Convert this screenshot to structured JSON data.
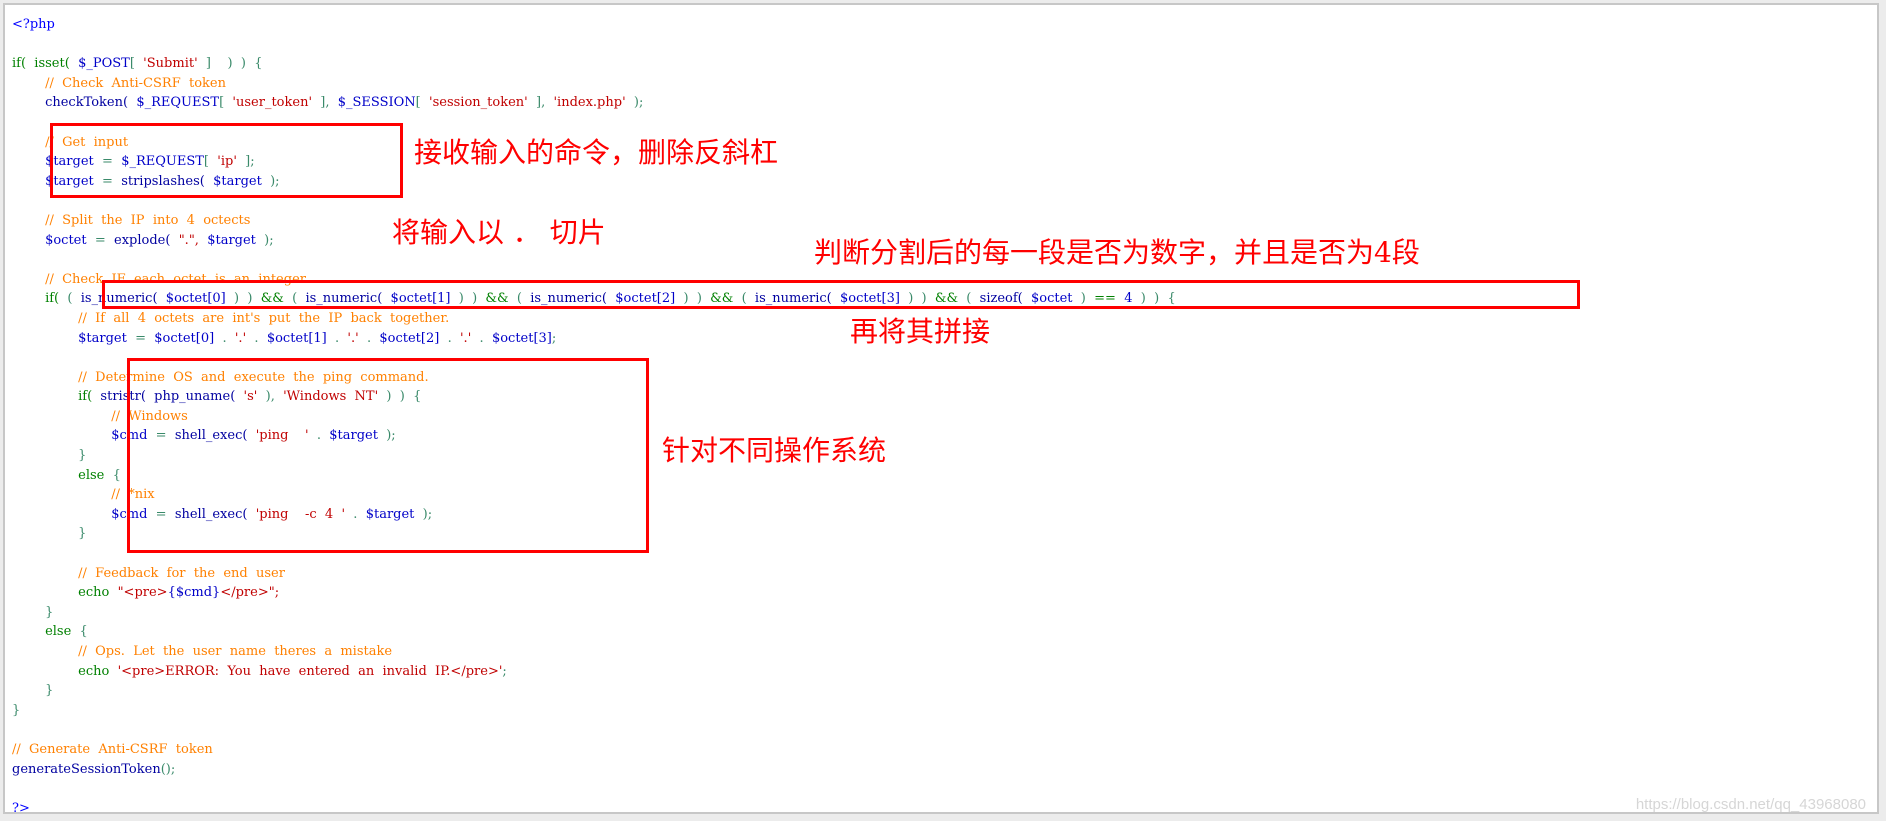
{
  "code": {
    "language": "php",
    "lines": [
      {
        "indent": 0,
        "tokens": [
          {
            "t": "<?php",
            "c": "ph"
          }
        ]
      },
      {
        "indent": 0,
        "tokens": []
      },
      {
        "indent": 0,
        "tokens": [
          {
            "t": "if(",
            "c": "kw"
          },
          {
            "t": "  isset(",
            "c": "kw"
          },
          {
            "t": "  $_POST",
            "c": "var"
          },
          {
            "t": "[",
            "c": "pn"
          },
          {
            "t": "  'Submit'",
            "c": "str"
          },
          {
            "t": "  ]",
            "c": "pn"
          },
          {
            "t": "    )  )  {",
            "c": "pn"
          }
        ]
      },
      {
        "indent": 1,
        "tokens": [
          {
            "t": "//  Check  Anti-CSRF  token",
            "c": "cm"
          }
        ]
      },
      {
        "indent": 1,
        "tokens": [
          {
            "t": "checkToken(",
            "c": "fn"
          },
          {
            "t": "  $_REQUEST",
            "c": "var"
          },
          {
            "t": "[",
            "c": "pn"
          },
          {
            "t": "  'user_token'",
            "c": "str"
          },
          {
            "t": "  ],",
            "c": "pn"
          },
          {
            "t": "  $_SESSION",
            "c": "var"
          },
          {
            "t": "[",
            "c": "pn"
          },
          {
            "t": "  'session_token'",
            "c": "str"
          },
          {
            "t": "  ],",
            "c": "pn"
          },
          {
            "t": "  'index.php'",
            "c": "str"
          },
          {
            "t": "  );",
            "c": "pn"
          }
        ]
      },
      {
        "indent": 0,
        "tokens": []
      },
      {
        "indent": 1,
        "tokens": [
          {
            "t": "//  Get  input",
            "c": "cm"
          }
        ]
      },
      {
        "indent": 1,
        "tokens": [
          {
            "t": "$target",
            "c": "var"
          },
          {
            "t": "  =  ",
            "c": "pn"
          },
          {
            "t": "$_REQUEST",
            "c": "var"
          },
          {
            "t": "[",
            "c": "pn"
          },
          {
            "t": "  'ip'",
            "c": "str"
          },
          {
            "t": "  ];",
            "c": "pn"
          }
        ]
      },
      {
        "indent": 1,
        "tokens": [
          {
            "t": "$target",
            "c": "var"
          },
          {
            "t": "  =  ",
            "c": "pn"
          },
          {
            "t": "stripslashes(",
            "c": "fn"
          },
          {
            "t": "  $target",
            "c": "var"
          },
          {
            "t": "  );",
            "c": "pn"
          }
        ]
      },
      {
        "indent": 0,
        "tokens": []
      },
      {
        "indent": 1,
        "tokens": [
          {
            "t": "//  Split  the  IP  into  4  octects",
            "c": "cm"
          }
        ]
      },
      {
        "indent": 1,
        "tokens": [
          {
            "t": "$octet",
            "c": "var"
          },
          {
            "t": "  =  ",
            "c": "pn"
          },
          {
            "t": "explode(",
            "c": "fn"
          },
          {
            "t": "  \".\",",
            "c": "str"
          },
          {
            "t": "  $target",
            "c": "var"
          },
          {
            "t": "  );",
            "c": "pn"
          }
        ]
      },
      {
        "indent": 0,
        "tokens": []
      },
      {
        "indent": 1,
        "tokens": [
          {
            "t": "//  Check  IF  each  octet  is  an  integer",
            "c": "cm"
          }
        ]
      },
      {
        "indent": 1,
        "tokens": [
          {
            "t": "if(",
            "c": "kw"
          },
          {
            "t": "  (  ",
            "c": "pn"
          },
          {
            "t": "is_numeric(",
            "c": "fn"
          },
          {
            "t": "  $octet[0]",
            "c": "var"
          },
          {
            "t": "  )  )  ",
            "c": "pn"
          },
          {
            "t": "&&",
            "c": "kw"
          },
          {
            "t": "  (  ",
            "c": "pn"
          },
          {
            "t": "is_numeric(",
            "c": "fn"
          },
          {
            "t": "  $octet[1]",
            "c": "var"
          },
          {
            "t": "  )  )  ",
            "c": "pn"
          },
          {
            "t": "&&",
            "c": "kw"
          },
          {
            "t": "  (  ",
            "c": "pn"
          },
          {
            "t": "is_numeric(",
            "c": "fn"
          },
          {
            "t": "  $octet[2]",
            "c": "var"
          },
          {
            "t": "  )  )  ",
            "c": "pn"
          },
          {
            "t": "&&",
            "c": "kw"
          },
          {
            "t": "  (  ",
            "c": "pn"
          },
          {
            "t": "is_numeric(",
            "c": "fn"
          },
          {
            "t": "  $octet[3]",
            "c": "var"
          },
          {
            "t": "  )  )  ",
            "c": "pn"
          },
          {
            "t": "&&",
            "c": "kw"
          },
          {
            "t": "  (  ",
            "c": "pn"
          },
          {
            "t": "sizeof(",
            "c": "fn"
          },
          {
            "t": "  $octet",
            "c": "var"
          },
          {
            "t": "  )  ",
            "c": "pn"
          },
          {
            "t": "==",
            "c": "kw"
          },
          {
            "t": "  4",
            "c": "var"
          },
          {
            "t": "  )  )  {",
            "c": "pn"
          }
        ]
      },
      {
        "indent": 2,
        "tokens": [
          {
            "t": "//  If  all  4  octets  are  int's  put  the  IP  back  together.",
            "c": "cm"
          }
        ]
      },
      {
        "indent": 2,
        "tokens": [
          {
            "t": "$target",
            "c": "var"
          },
          {
            "t": "  =  ",
            "c": "pn"
          },
          {
            "t": "$octet[0]",
            "c": "var"
          },
          {
            "t": "  .  ",
            "c": "pn"
          },
          {
            "t": "'.'",
            "c": "str"
          },
          {
            "t": "  .  ",
            "c": "pn"
          },
          {
            "t": "$octet[1]",
            "c": "var"
          },
          {
            "t": "  .  ",
            "c": "pn"
          },
          {
            "t": "'.'",
            "c": "str"
          },
          {
            "t": "  .  ",
            "c": "pn"
          },
          {
            "t": "$octet[2]",
            "c": "var"
          },
          {
            "t": "  .  ",
            "c": "pn"
          },
          {
            "t": "'.'",
            "c": "str"
          },
          {
            "t": "  .  ",
            "c": "pn"
          },
          {
            "t": "$octet[3]",
            "c": "var"
          },
          {
            "t": ";",
            "c": "pn"
          }
        ]
      },
      {
        "indent": 0,
        "tokens": []
      },
      {
        "indent": 2,
        "tokens": [
          {
            "t": "//  Determine  OS  and  execute  the  ping  command.",
            "c": "cm"
          }
        ]
      },
      {
        "indent": 2,
        "tokens": [
          {
            "t": "if(",
            "c": "kw"
          },
          {
            "t": "  stristr(",
            "c": "fn"
          },
          {
            "t": "  php_uname(",
            "c": "fn"
          },
          {
            "t": "  's'",
            "c": "str"
          },
          {
            "t": "  ),",
            "c": "pn"
          },
          {
            "t": "  'Windows  NT'",
            "c": "str"
          },
          {
            "t": "  )  )  {",
            "c": "pn"
          }
        ]
      },
      {
        "indent": 3,
        "tokens": [
          {
            "t": "//  Windows",
            "c": "cm"
          }
        ]
      },
      {
        "indent": 3,
        "tokens": [
          {
            "t": "$cmd",
            "c": "var"
          },
          {
            "t": "  =  ",
            "c": "pn"
          },
          {
            "t": "shell_exec(",
            "c": "fn"
          },
          {
            "t": "  'ping    '",
            "c": "str"
          },
          {
            "t": "  .  ",
            "c": "pn"
          },
          {
            "t": "$target",
            "c": "var"
          },
          {
            "t": "  );",
            "c": "pn"
          }
        ]
      },
      {
        "indent": 2,
        "tokens": [
          {
            "t": "}",
            "c": "pn"
          }
        ]
      },
      {
        "indent": 2,
        "tokens": [
          {
            "t": "else",
            "c": "kw"
          },
          {
            "t": "  {",
            "c": "pn"
          }
        ]
      },
      {
        "indent": 3,
        "tokens": [
          {
            "t": "//  *nix",
            "c": "cm"
          }
        ]
      },
      {
        "indent": 3,
        "tokens": [
          {
            "t": "$cmd",
            "c": "var"
          },
          {
            "t": "  =  ",
            "c": "pn"
          },
          {
            "t": "shell_exec(",
            "c": "fn"
          },
          {
            "t": "  'ping    -c  4  '",
            "c": "str"
          },
          {
            "t": "  .  ",
            "c": "pn"
          },
          {
            "t": "$target",
            "c": "var"
          },
          {
            "t": "  );",
            "c": "pn"
          }
        ]
      },
      {
        "indent": 2,
        "tokens": [
          {
            "t": "}",
            "c": "pn"
          }
        ]
      },
      {
        "indent": 0,
        "tokens": []
      },
      {
        "indent": 2,
        "tokens": [
          {
            "t": "//  Feedback  for  the  end  user",
            "c": "cm"
          }
        ]
      },
      {
        "indent": 2,
        "tokens": [
          {
            "t": "echo",
            "c": "kw"
          },
          {
            "t": "  \"<pre>",
            "c": "str"
          },
          {
            "t": "{$cmd}",
            "c": "var"
          },
          {
            "t": "</pre>\";",
            "c": "str"
          }
        ]
      },
      {
        "indent": 1,
        "tokens": [
          {
            "t": "}",
            "c": "pn"
          }
        ]
      },
      {
        "indent": 1,
        "tokens": [
          {
            "t": "else",
            "c": "kw"
          },
          {
            "t": "  {",
            "c": "pn"
          }
        ]
      },
      {
        "indent": 2,
        "tokens": [
          {
            "t": "//  Ops.  Let  the  user  name  theres  a  mistake",
            "c": "cm"
          }
        ]
      },
      {
        "indent": 2,
        "tokens": [
          {
            "t": "echo",
            "c": "kw"
          },
          {
            "t": "  '<pre>ERROR:  You  have  entered  an  invalid  IP.</pre>'",
            "c": "str"
          },
          {
            "t": ";",
            "c": "pn"
          }
        ]
      },
      {
        "indent": 1,
        "tokens": [
          {
            "t": "}",
            "c": "pn"
          }
        ]
      },
      {
        "indent": 0,
        "tokens": [
          {
            "t": "}",
            "c": "pn"
          }
        ]
      },
      {
        "indent": 0,
        "tokens": []
      },
      {
        "indent": 0,
        "tokens": [
          {
            "t": "//  Generate  Anti-CSRF  token",
            "c": "cm"
          }
        ]
      },
      {
        "indent": 0,
        "tokens": [
          {
            "t": "generateSessionToken",
            "c": "fn"
          },
          {
            "t": "();",
            "c": "pn"
          }
        ]
      },
      {
        "indent": 0,
        "tokens": []
      },
      {
        "indent": 0,
        "tokens": [
          {
            "t": "?>",
            "c": "ph"
          }
        ]
      }
    ]
  },
  "annotations": {
    "get_input": "接收输入的命令，删除反斜杠",
    "split": "将输入以 ． 切片",
    "check_numeric": "判断分割后的每一段是否为数字，并且是否为4段",
    "rejoin": "再将其拼接",
    "os_branch": "针对不同操作系统"
  },
  "watermark": "https://blog.csdn.net/qq_43968080",
  "colors": {
    "annotation": "#ff0000",
    "comment": "#ff8000",
    "string": "#c00000",
    "keyword": "#008000",
    "variable": "#0000c8"
  }
}
